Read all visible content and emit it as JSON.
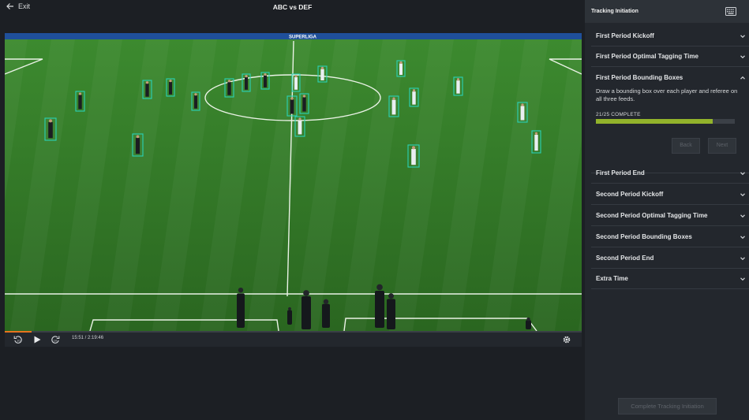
{
  "topbar": {
    "exit_label": "Exit",
    "match_title": "ABC vs DEF"
  },
  "video": {
    "timecode": "15:51 / 2:19:46",
    "progress": 0.047,
    "ad_board_text": "SUPERLIGA"
  },
  "panel": {
    "title": "Tracking Initiation",
    "sections": [
      {
        "label": "First Period Kickoff",
        "expanded": false
      },
      {
        "label": "First Period Optimal Tagging Time",
        "expanded": false
      },
      {
        "label": "First Period Bounding Boxes",
        "expanded": true
      },
      {
        "label": "First Period End",
        "expanded": false
      },
      {
        "label": "Second Period Kickoff",
        "expanded": false
      },
      {
        "label": "Second Period Optimal Tagging Time",
        "expanded": false
      },
      {
        "label": "Second Period Bounding Boxes",
        "expanded": false
      },
      {
        "label": "Second Period End",
        "expanded": false
      },
      {
        "label": "Extra Time",
        "expanded": false
      }
    ],
    "expanded_description": "Draw a bounding box over each player and referee on all three feeds.",
    "completion_text": "21/25 COMPLETE",
    "completion_fraction": 0.84,
    "back_label": "Back",
    "next_label": "Next",
    "complete_button_label": "Complete Tracking Initiation"
  },
  "colors": {
    "bbox": "#2ad1b7",
    "progress_accent": "#e8731e",
    "completion_bar": "#92b32b",
    "pitch": "#2f7226"
  }
}
